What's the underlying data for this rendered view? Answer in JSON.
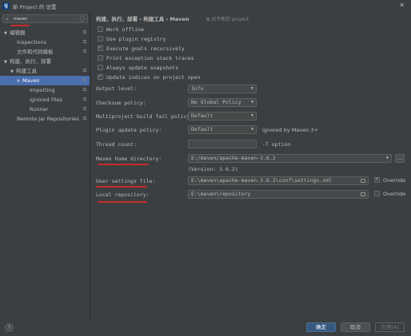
{
  "window": {
    "title": "新 Project 的 设置",
    "app_icon": "IJ",
    "close": "✕"
  },
  "sidebar": {
    "search": {
      "value": "maven",
      "placeholder": ""
    },
    "items": [
      {
        "label": "编辑器",
        "level": 0,
        "arrow": "▼",
        "pin": true
      },
      {
        "label": "Inspections",
        "level": 1,
        "pin": true
      },
      {
        "label": "文件和代码模板",
        "level": 1,
        "pin": true
      },
      {
        "label": "构建、执行、部署",
        "level": 0,
        "arrow": "▼",
        "pin": false
      },
      {
        "label": "构建工具",
        "level": 1,
        "arrow": "▼",
        "pin": true
      },
      {
        "label": "Maven",
        "level": 2,
        "arrow": "▼",
        "pin": true,
        "selected": true
      },
      {
        "label": "Importing",
        "level": 3,
        "pin": true
      },
      {
        "label": "Ignored Files",
        "level": 3,
        "pin": true
      },
      {
        "label": "Runner",
        "level": 3,
        "pin": true
      },
      {
        "label": "Remote Jar Repositories",
        "level": 1,
        "pin": true
      }
    ]
  },
  "header": {
    "breadcrumb": "构建、执行、部署 › 构建工具 › Maven",
    "scope_note": "对于新的 project"
  },
  "checkboxes": [
    {
      "label": "Work offline",
      "checked": false
    },
    {
      "label": "Use plugin registry",
      "checked": false
    },
    {
      "label": "Execute goals recursively",
      "checked": true
    },
    {
      "label": "Print exception stack traces",
      "checked": false
    },
    {
      "label": "Always update snapshots",
      "checked": false
    },
    {
      "label": "Update indices on project open",
      "checked": true
    }
  ],
  "fields": {
    "output_level": {
      "label": "Output level:",
      "value": "Info"
    },
    "checksum_policy": {
      "label": "Checksum policy:",
      "value": "No Global Policy"
    },
    "multiproject_fail_policy": {
      "label": "Multiproject build fail policy:",
      "value": "Default"
    },
    "plugin_update_policy": {
      "label": "Plugin update policy:",
      "value": "Default",
      "note": "ignored by Maven 3+"
    },
    "thread_count": {
      "label": "Thread count:",
      "value": "",
      "note": "-T option"
    },
    "maven_home": {
      "label": "Maven home directory:",
      "value": "E:/maven/apache-maven-3.6.2",
      "version": "(Version: 3.6.2)"
    },
    "user_settings": {
      "label": "User settings file:",
      "value": "E:\\maven\\apache-maven-3.6.2\\conf\\settings.xml",
      "override_label": "Override",
      "override_checked": true
    },
    "local_repo": {
      "label": "Local repository:",
      "value": "E:\\maven\\repository",
      "override_label": "Override",
      "override_checked": false
    }
  },
  "buttons": {
    "help": "?",
    "ok": "确定",
    "cancel": "取消",
    "apply": "应用(A)",
    "browse": "..."
  },
  "colors": {
    "background": "#3c3f41",
    "selection": "#4b6eaf",
    "primary_button": "#365880",
    "annotation_red": "#c52b2b"
  }
}
